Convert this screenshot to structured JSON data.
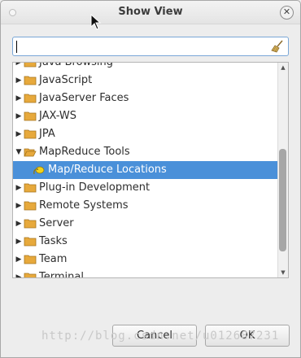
{
  "window": {
    "title": "Show View"
  },
  "search": {
    "value": "",
    "placeholder": ""
  },
  "tree": {
    "items": [
      {
        "label": "Java Browsing",
        "expanded": false,
        "selected": false,
        "level": 0
      },
      {
        "label": "JavaScript",
        "expanded": false,
        "selected": false,
        "level": 0
      },
      {
        "label": "JavaServer Faces",
        "expanded": false,
        "selected": false,
        "level": 0
      },
      {
        "label": "JAX-WS",
        "expanded": false,
        "selected": false,
        "level": 0
      },
      {
        "label": "JPA",
        "expanded": false,
        "selected": false,
        "level": 0
      },
      {
        "label": "MapReduce Tools",
        "expanded": true,
        "selected": false,
        "level": 0
      },
      {
        "label": "Map/Reduce Locations",
        "expanded": false,
        "selected": true,
        "level": 1
      },
      {
        "label": "Plug-in Development",
        "expanded": false,
        "selected": false,
        "level": 0
      },
      {
        "label": "Remote Systems",
        "expanded": false,
        "selected": false,
        "level": 0
      },
      {
        "label": "Server",
        "expanded": false,
        "selected": false,
        "level": 0
      },
      {
        "label": "Tasks",
        "expanded": false,
        "selected": false,
        "level": 0
      },
      {
        "label": "Team",
        "expanded": false,
        "selected": false,
        "level": 0
      },
      {
        "label": "Terminal",
        "expanded": false,
        "selected": false,
        "level": 0
      }
    ]
  },
  "buttons": {
    "cancel": "Cancel",
    "ok": "OK"
  },
  "watermark": "http://blog.csdn.net/u012687231",
  "colors": {
    "selection": "#4a90d9",
    "folder": "#e7a93c"
  }
}
